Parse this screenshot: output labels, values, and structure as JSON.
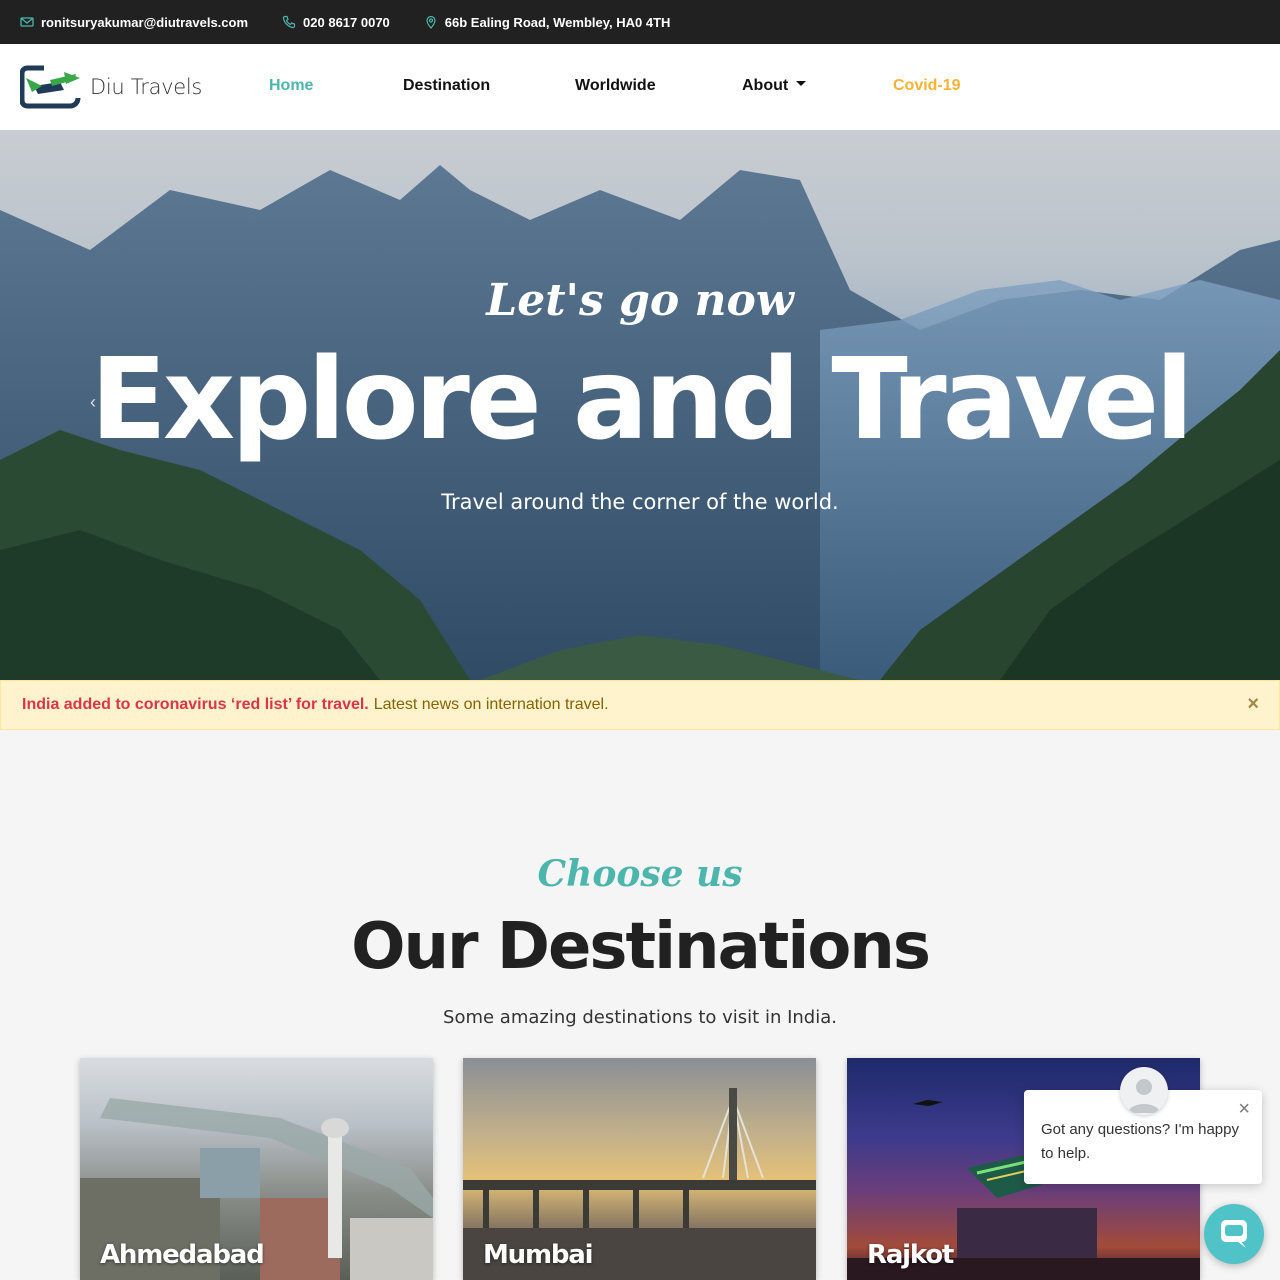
{
  "topbar": {
    "email": "ronitsuryakumar@diutravels.com",
    "phone": "020 8617 0070",
    "address": "66b Ealing Road, Wembley, HA0 4TH"
  },
  "nav": {
    "brand": "Diu Travels",
    "items": [
      {
        "label": "Home",
        "active": true
      },
      {
        "label": "Destination"
      },
      {
        "label": "Worldwide"
      },
      {
        "label": "About",
        "dropdown": true
      },
      {
        "label": "Covid-19",
        "highlight": true
      }
    ]
  },
  "hero": {
    "script": "Let's go now",
    "title": "Explore and Travel",
    "subtitle": "Travel around the corner of the world."
  },
  "alert": {
    "strong": "India added to coronavirus ‘red list’ for travel.",
    "text": "Latest news on internation travel.",
    "close": "×"
  },
  "destinations": {
    "script": "Choose us",
    "title": "Our Destinations",
    "subtitle": "Some amazing destinations to visit in India.",
    "cards": [
      {
        "name": "Ahmedabad"
      },
      {
        "name": "Mumbai"
      },
      {
        "name": "Rajkot"
      }
    ]
  },
  "chat": {
    "message": "Got any questions? I'm happy to help.",
    "close": "×"
  },
  "colors": {
    "accent": "#4db6ac",
    "covid": "#f9b233",
    "alert_red": "#dc3545",
    "chat": "#4fc3c7"
  }
}
